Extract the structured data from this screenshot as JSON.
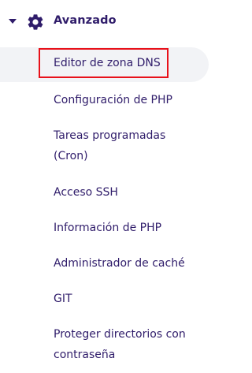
{
  "section": {
    "title": "Avanzado",
    "icon": "gear-icon",
    "expanded": true
  },
  "items": [
    {
      "label": "Editor de zona DNS",
      "active": true
    },
    {
      "label": "Configuración de PHP"
    },
    {
      "label": "Tareas programadas\n(Cron)"
    },
    {
      "label": "Acceso SSH"
    },
    {
      "label": "Información de PHP"
    },
    {
      "label": "Administrador de caché"
    },
    {
      "label": "GIT"
    },
    {
      "label": "Proteger directorios con\ncontraseña"
    }
  ],
  "colors": {
    "text": "#2f1c6a",
    "active_background": "#f2f3f6",
    "highlight_border": "#e8111a"
  }
}
